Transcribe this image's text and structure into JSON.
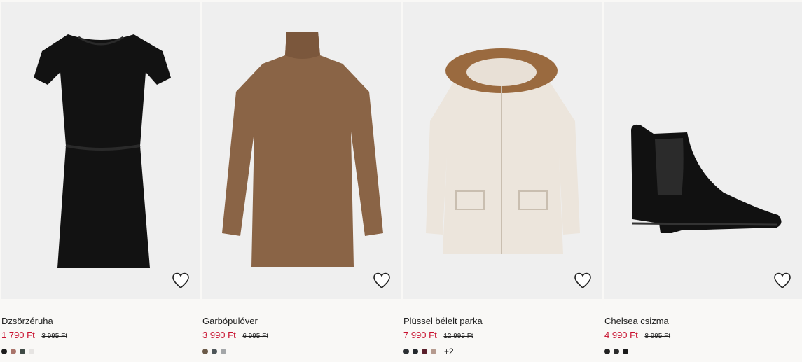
{
  "products": [
    {
      "title": "Dzsörzéruha",
      "sale_price": "1 790 Ft",
      "old_price": "3 995 Ft",
      "swatches": [
        "#1c1c1c",
        "#a9746a",
        "#3f4a45",
        "#e6e4e2"
      ],
      "more": "",
      "icon": "heart-outline-icon"
    },
    {
      "title": "Garbópulóver",
      "sale_price": "3 990 Ft",
      "old_price": "6 995 Ft",
      "swatches": [
        "#6b5a48",
        "#4d5558",
        "#a3a6a8"
      ],
      "more": "",
      "icon": "heart-outline-icon"
    },
    {
      "title": "Plüssel bélelt parka",
      "sale_price": "7 990 Ft",
      "old_price": "12 995 Ft",
      "swatches": [
        "#2b2f33",
        "#23272c",
        "#5a1f2b",
        "#b59a8e"
      ],
      "more": "+2",
      "icon": "heart-outline-icon"
    },
    {
      "title": "Chelsea csizma",
      "sale_price": "4 990 Ft",
      "old_price": "8 995 Ft",
      "swatches": [
        "#222222",
        "#2b2b2b",
        "#1a1a1a"
      ],
      "more": "",
      "icon": "heart-outline-icon"
    }
  ],
  "colors": {
    "sale": "#c8102e",
    "background": "#f9f8f6",
    "image_bg": "#efefef"
  }
}
